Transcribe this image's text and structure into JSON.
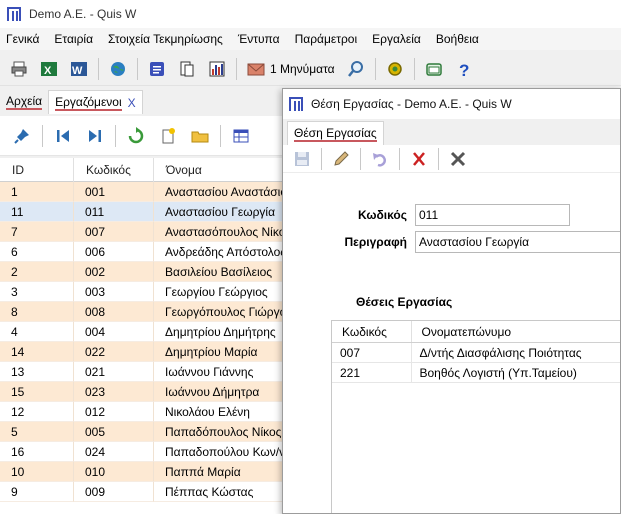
{
  "window": {
    "title": "Demo A.E. - Quis W"
  },
  "menu": [
    "Γενικά",
    "Εταιρία",
    "Στοιχεία Τεκμηρίωσης",
    "Έντυπα",
    "Παράμετροι",
    "Εργαλεία",
    "Βοήθεια"
  ],
  "toolbar": {
    "messages_label": "1 Μηνύματα"
  },
  "left_tabs": {
    "tab1": "Αρχεία",
    "tab2": "Εργαζόμενοι",
    "close": "X"
  },
  "grid": {
    "headers": {
      "id": "ID",
      "code": "Κωδικός",
      "name": "Όνομα"
    },
    "rows": [
      {
        "id": "1",
        "code": "001",
        "name": "Αναστασίου Αναστάσιος"
      },
      {
        "id": "11",
        "code": "011",
        "name": "Αναστασίου Γεωργία"
      },
      {
        "id": "7",
        "code": "007",
        "name": "Αναστασόπουλος Νίκος"
      },
      {
        "id": "6",
        "code": "006",
        "name": "Ανδρεάδης Απόστολος"
      },
      {
        "id": "2",
        "code": "002",
        "name": "Βασιλείου Βασίλειος"
      },
      {
        "id": "3",
        "code": "003",
        "name": "Γεωργίου Γεώργιος"
      },
      {
        "id": "8",
        "code": "008",
        "name": "Γεωργόπουλος Γιώργος"
      },
      {
        "id": "4",
        "code": "004",
        "name": "Δημητρίου Δημήτρης"
      },
      {
        "id": "14",
        "code": "022",
        "name": "Δημητρίου Μαρία"
      },
      {
        "id": "13",
        "code": "021",
        "name": "Ιωάννου Γιάννης"
      },
      {
        "id": "15",
        "code": "023",
        "name": "Ιωάννου Δήμητρα"
      },
      {
        "id": "12",
        "code": "012",
        "name": "Νικολάου Ελένη"
      },
      {
        "id": "5",
        "code": "005",
        "name": "Παπαδόπουλος Νίκος"
      },
      {
        "id": "16",
        "code": "024",
        "name": "Παπαδοπούλου Κων/να"
      },
      {
        "id": "10",
        "code": "010",
        "name": "Παππά Μαρία"
      },
      {
        "id": "9",
        "code": "009",
        "name": "Πέππας Κώστας"
      }
    ],
    "selected_index": 1
  },
  "modal": {
    "title": "Θέση Εργασίας - Demo A.E. - Quis W",
    "tab": "Θέση Εργασίας",
    "code_label": "Κωδικός",
    "code_value": "011",
    "desc_label": "Περιγραφή",
    "desc_value": "Αναστασίου Γεωργία",
    "section_title": "Θέσεις Εργασίας",
    "sub_headers": {
      "code": "Κωδικός",
      "name": "Ονοματεπώνυμο"
    },
    "sub_rows": [
      {
        "code": "007",
        "name": "Δ/ντής Διασφάλισης Ποιότητας"
      },
      {
        "code": "221",
        "name": "Βοηθός Λογιστή (Υπ.Ταμείου)"
      }
    ]
  },
  "colors": {
    "row_alt": "#fde9d3",
    "row_selected": "#dde8f5",
    "accent": "#3a4fb8",
    "tab_underline": "#c8585e"
  },
  "icons": [
    "app-logo-icon",
    "printer-icon",
    "excel-icon",
    "word-icon",
    "globe-icon",
    "calendar-icon",
    "pages-icon",
    "bar-chart-icon",
    "envelope-icon",
    "search-icon",
    "gear-icon",
    "window-icon",
    "help-icon",
    "pin-icon",
    "first-icon",
    "last-icon",
    "refresh-icon",
    "new-icon",
    "folder-icon",
    "grid-icon",
    "save-icon",
    "edit-icon",
    "undo-icon",
    "delete-icon",
    "cancel-icon"
  ]
}
